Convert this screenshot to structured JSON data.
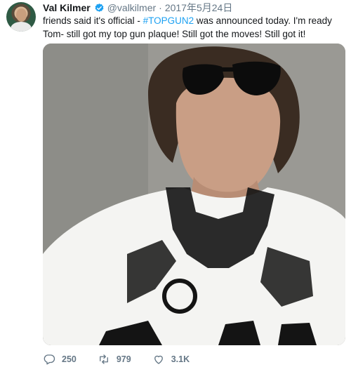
{
  "tweet": {
    "author_name": "Val Kilmer",
    "handle": "@valkilmer",
    "separator": "·",
    "date": "2017年5月24日",
    "text_before": "friends said it's official - ",
    "hashtag": "#TOPGUN2",
    "text_after": " was announced today. I'm ready Tom- still got my top gun plaque! Still got the moves! Still got it!",
    "image_alt": "Selfie wearing sunglasses and a Top Gun t-shirt"
  },
  "actions": {
    "replies": "250",
    "retweets": "979",
    "likes": "3.1K"
  },
  "colors": {
    "link": "#1da1f2",
    "muted": "#657786",
    "verified": "#1da1f2"
  },
  "icons": [
    "verified-badge-icon",
    "reply-icon",
    "retweet-icon",
    "like-icon"
  ]
}
